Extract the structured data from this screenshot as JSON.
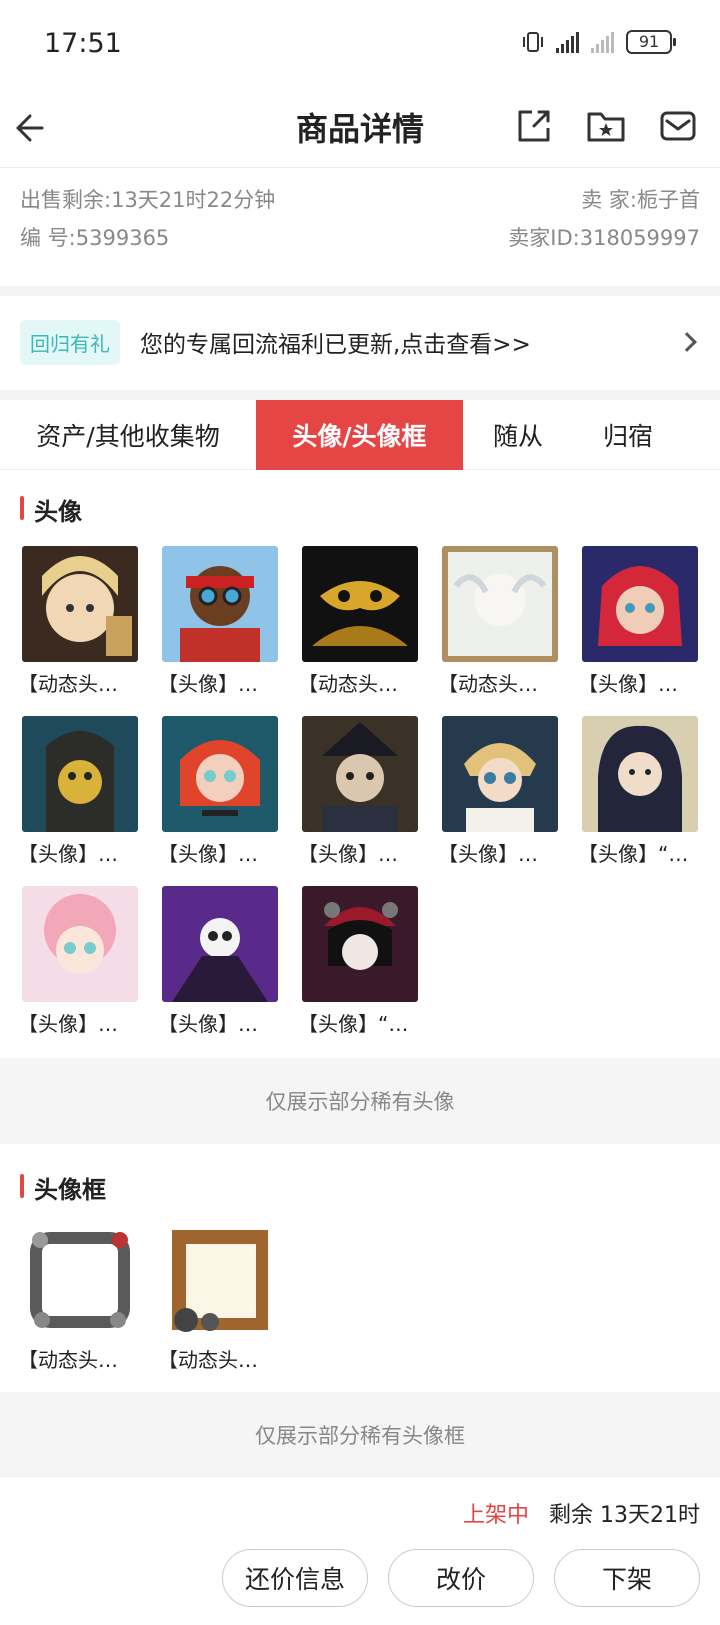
{
  "status_bar": {
    "time": "17:51",
    "battery": "91"
  },
  "nav": {
    "title": "商品详情"
  },
  "info": {
    "remaining_label": "出售剩余:",
    "remaining_value": "13天21时22分钟",
    "seller_label": "卖 家:",
    "seller_value": "栀子首",
    "id_label": "编 号:",
    "id_value": "5399365",
    "seller_id_label": "卖家ID:",
    "seller_id_value": "318059997"
  },
  "banner": {
    "tag": "回归有礼",
    "text": "您的专属回流福利已更新,点击查看>>"
  },
  "tabs": [
    {
      "label": "资产/其他收集物",
      "active": false
    },
    {
      "label": "头像/头像框",
      "active": true
    },
    {
      "label": "随从",
      "active": false
    },
    {
      "label": "归宿",
      "active": false
    }
  ],
  "avatars": {
    "title": "头像",
    "items": [
      "【动态头…",
      "【头像】…",
      "【动态头…",
      "【动态头…",
      "【头像】…",
      "【头像】…",
      "【头像】…",
      "【头像】…",
      "【头像】…",
      "【头像】“…",
      "【头像】…",
      "【头像】…",
      "【头像】“…"
    ],
    "notice": "仅展示部分稀有头像"
  },
  "frames": {
    "title": "头像框",
    "items": [
      "【动态头…",
      "【动态头…"
    ],
    "notice": "仅展示部分稀有头像框"
  },
  "footer": {
    "status": "上架中",
    "remaining": "剩余 13天21时",
    "buttons": [
      "还价信息",
      "改价",
      "下架"
    ]
  },
  "colors": {
    "accent": "#e64545",
    "tag_text": "#3cb8b6",
    "tag_bg": "#e4f7f7"
  }
}
